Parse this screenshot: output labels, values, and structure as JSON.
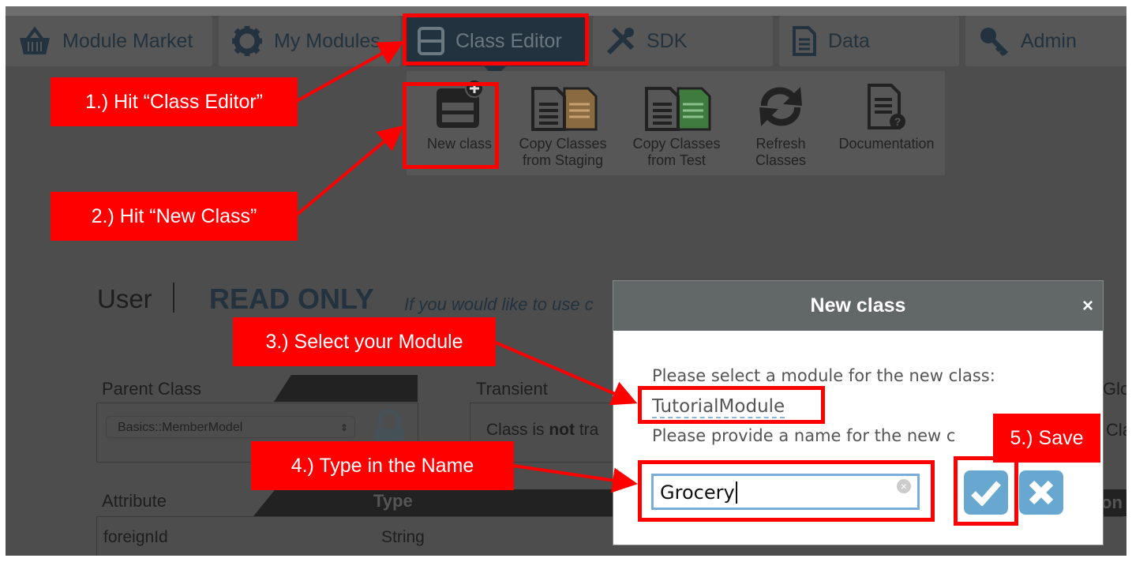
{
  "nav": {
    "tabs": [
      {
        "label": "Module Market",
        "icon": "basket-icon"
      },
      {
        "label": "My Modules",
        "icon": "gear-icon"
      },
      {
        "label": "Class Editor",
        "icon": "class-icon",
        "active": true
      },
      {
        "label": "SDK",
        "icon": "tools-icon"
      },
      {
        "label": "Data",
        "icon": "document-icon"
      },
      {
        "label": "Admin",
        "icon": "key-icon"
      }
    ]
  },
  "toolbar": {
    "items": [
      {
        "line1": "New class",
        "line2": ""
      },
      {
        "line1": "Copy Classes",
        "line2": "from Staging"
      },
      {
        "line1": "Copy Classes",
        "line2": "from Test"
      },
      {
        "line1": "Refresh",
        "line2": "Classes"
      },
      {
        "line1": "Documentation",
        "line2": ""
      }
    ]
  },
  "content": {
    "class_name": "User",
    "read_only": "READ ONLY",
    "read_only_hint": "If you would like to use c",
    "parent_class_label": "Parent Class",
    "parent_class_value": "Basics::MemberModel",
    "transient_label": "Transient",
    "transient_text_pre": "Class is ",
    "transient_text_bold": "not",
    "transient_text_post": " tra",
    "global_label_partial": "Glo",
    "global_value_partial": "Cla",
    "attribute_header": "Attribute",
    "type_header": "Type",
    "extra_header_partial": "on",
    "rows": [
      {
        "attribute": "foreignId",
        "type": "String"
      }
    ]
  },
  "dialog": {
    "title": "New class",
    "close": "×",
    "module_prompt": "Please select a module for the new class:",
    "module_value": "TutorialModule",
    "name_prompt": "Please provide a name for the new c",
    "name_value": "Grocery"
  },
  "annotations": {
    "step1": "1.) Hit “Class Editor”",
    "step2": "2.) Hit “New Class”",
    "step3": "3.)  Select your Module",
    "step4": "4.)  Type in the Name",
    "step5": "5.)  Save",
    "color": "#ff0000"
  }
}
